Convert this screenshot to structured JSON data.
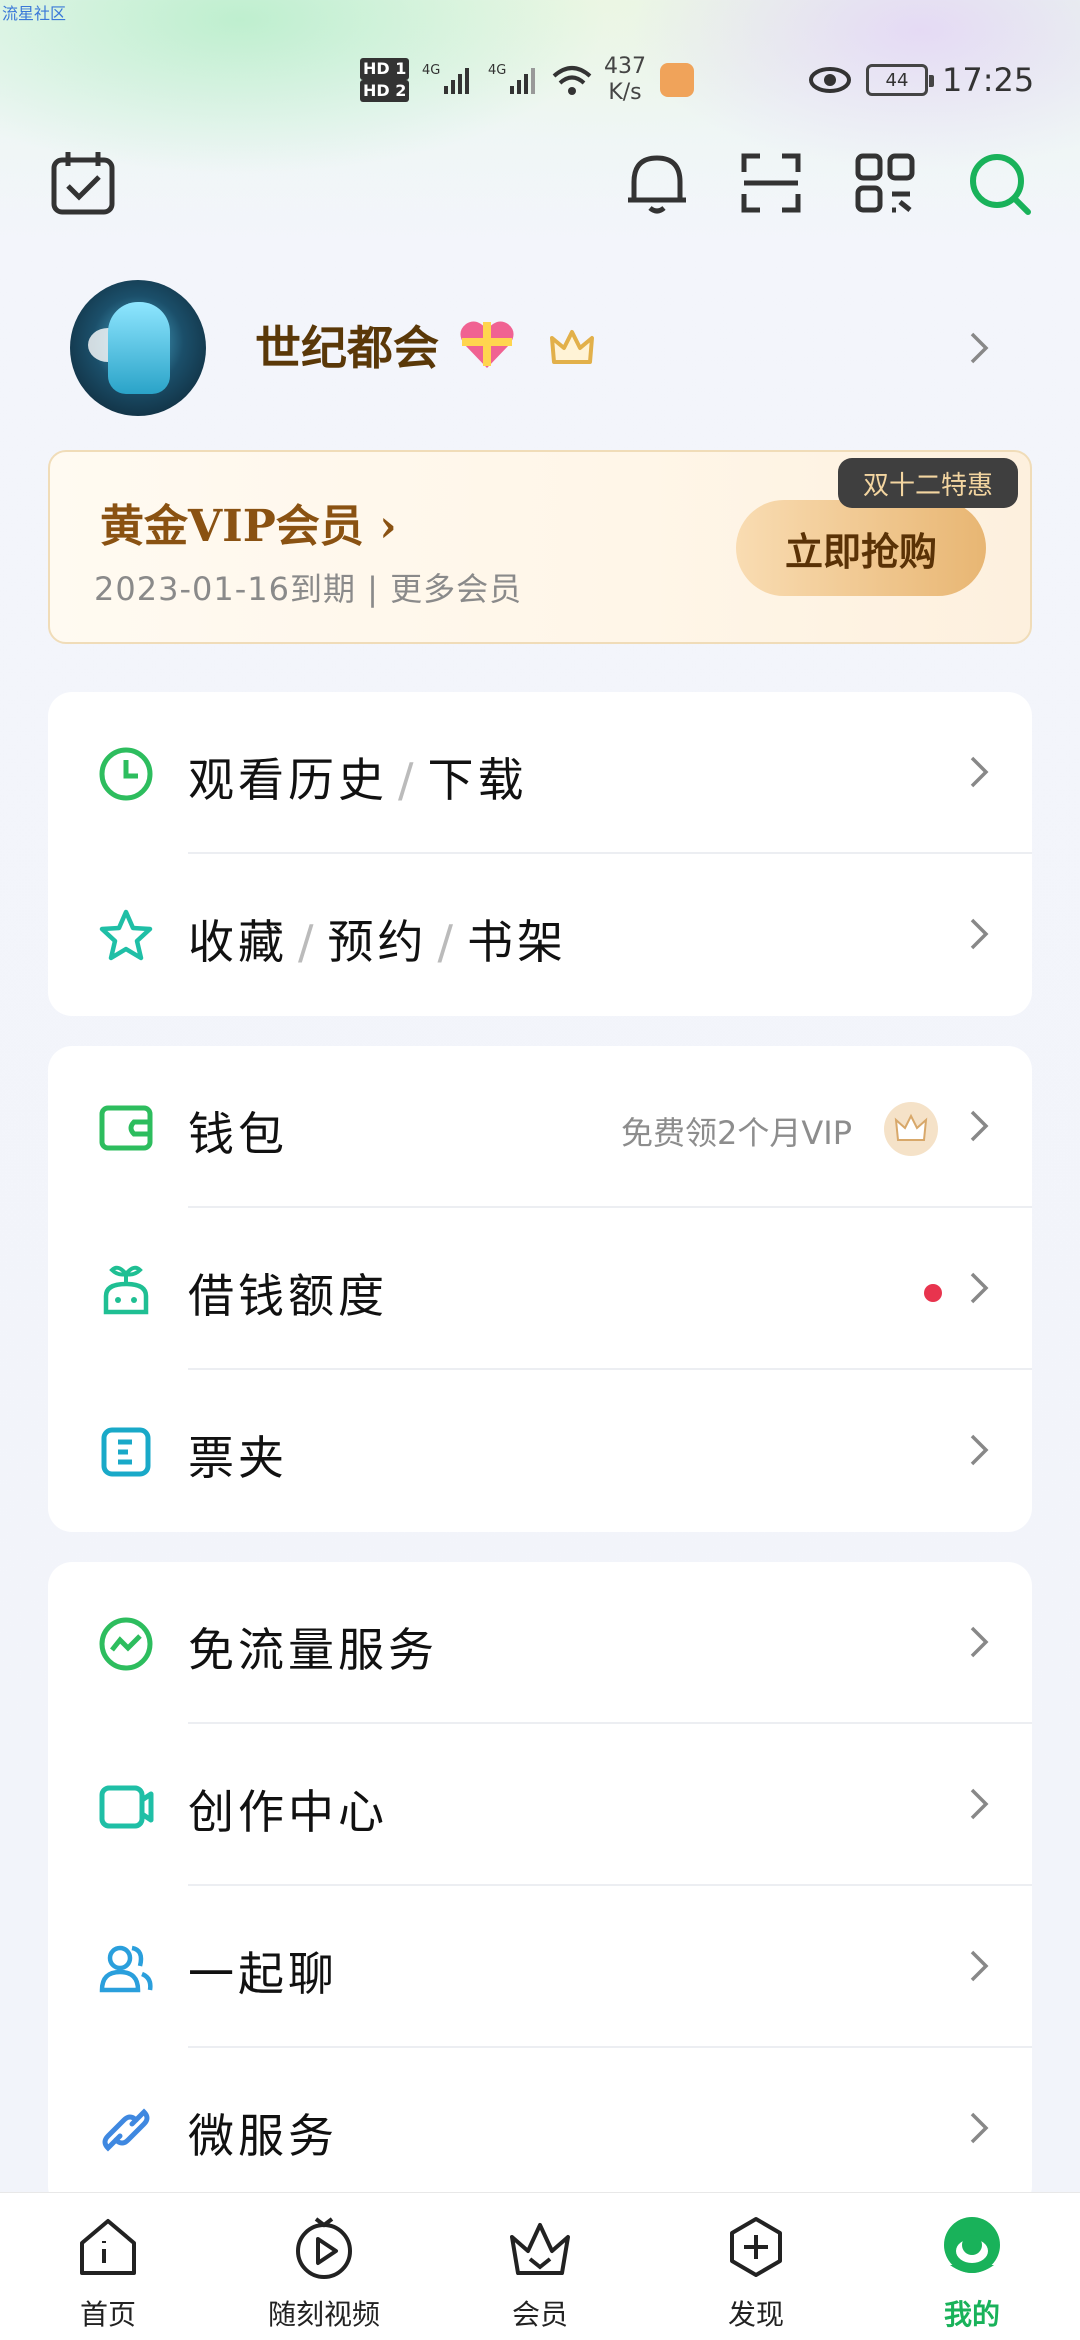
{
  "watermark": "流星社区",
  "status_bar": {
    "sim1": "HD 1",
    "sim2": "HD 2",
    "net1": "4G",
    "net2": "4G",
    "speed_value": "437",
    "speed_unit": "K/s",
    "battery": "44",
    "time": "17:25"
  },
  "header": {
    "icons": [
      "calendar-check-icon",
      "bell-icon",
      "scan-icon",
      "qr-code-icon",
      "search-icon"
    ]
  },
  "profile": {
    "username": "世纪都会"
  },
  "vip": {
    "title": "黄金VIP会员 ›",
    "subtitle": "2023-01-16到期 | 更多会员",
    "button": "立即抢购",
    "tag": "双十二特惠",
    "colors": {
      "gold": "#8a5212",
      "button_start": "#f9dcb2",
      "button_end": "#e8b673"
    }
  },
  "groups": [
    {
      "items": [
        {
          "icon": "clock-icon",
          "parts": [
            "观看历史",
            "下载"
          ]
        },
        {
          "icon": "star-icon",
          "parts": [
            "收藏",
            "预约",
            "书架"
          ]
        }
      ]
    },
    {
      "items": [
        {
          "icon": "wallet-icon",
          "label": "钱包",
          "extra": "免费领2个月VIP"
        },
        {
          "icon": "sprout-icon",
          "label": "借钱额度"
        },
        {
          "icon": "ticket-icon",
          "label": "票夹"
        }
      ]
    },
    {
      "items": [
        {
          "icon": "traffic-icon",
          "label": "免流量服务"
        },
        {
          "icon": "video-camera-icon",
          "label": "创作中心"
        },
        {
          "icon": "users-icon",
          "label": "一起聊"
        },
        {
          "icon": "link-icon",
          "label": "微服务"
        }
      ]
    }
  ],
  "bottom_nav": [
    {
      "label": "首页",
      "icon": "home-icon"
    },
    {
      "label": "随刻视频",
      "icon": "play-circle-icon"
    },
    {
      "label": "会员",
      "icon": "vip-crown-icon"
    },
    {
      "label": "发现",
      "icon": "plus-hexagon-icon"
    },
    {
      "label": "我的",
      "icon": "profile-face-icon",
      "active": true
    }
  ],
  "accent_color": "#19b25a"
}
